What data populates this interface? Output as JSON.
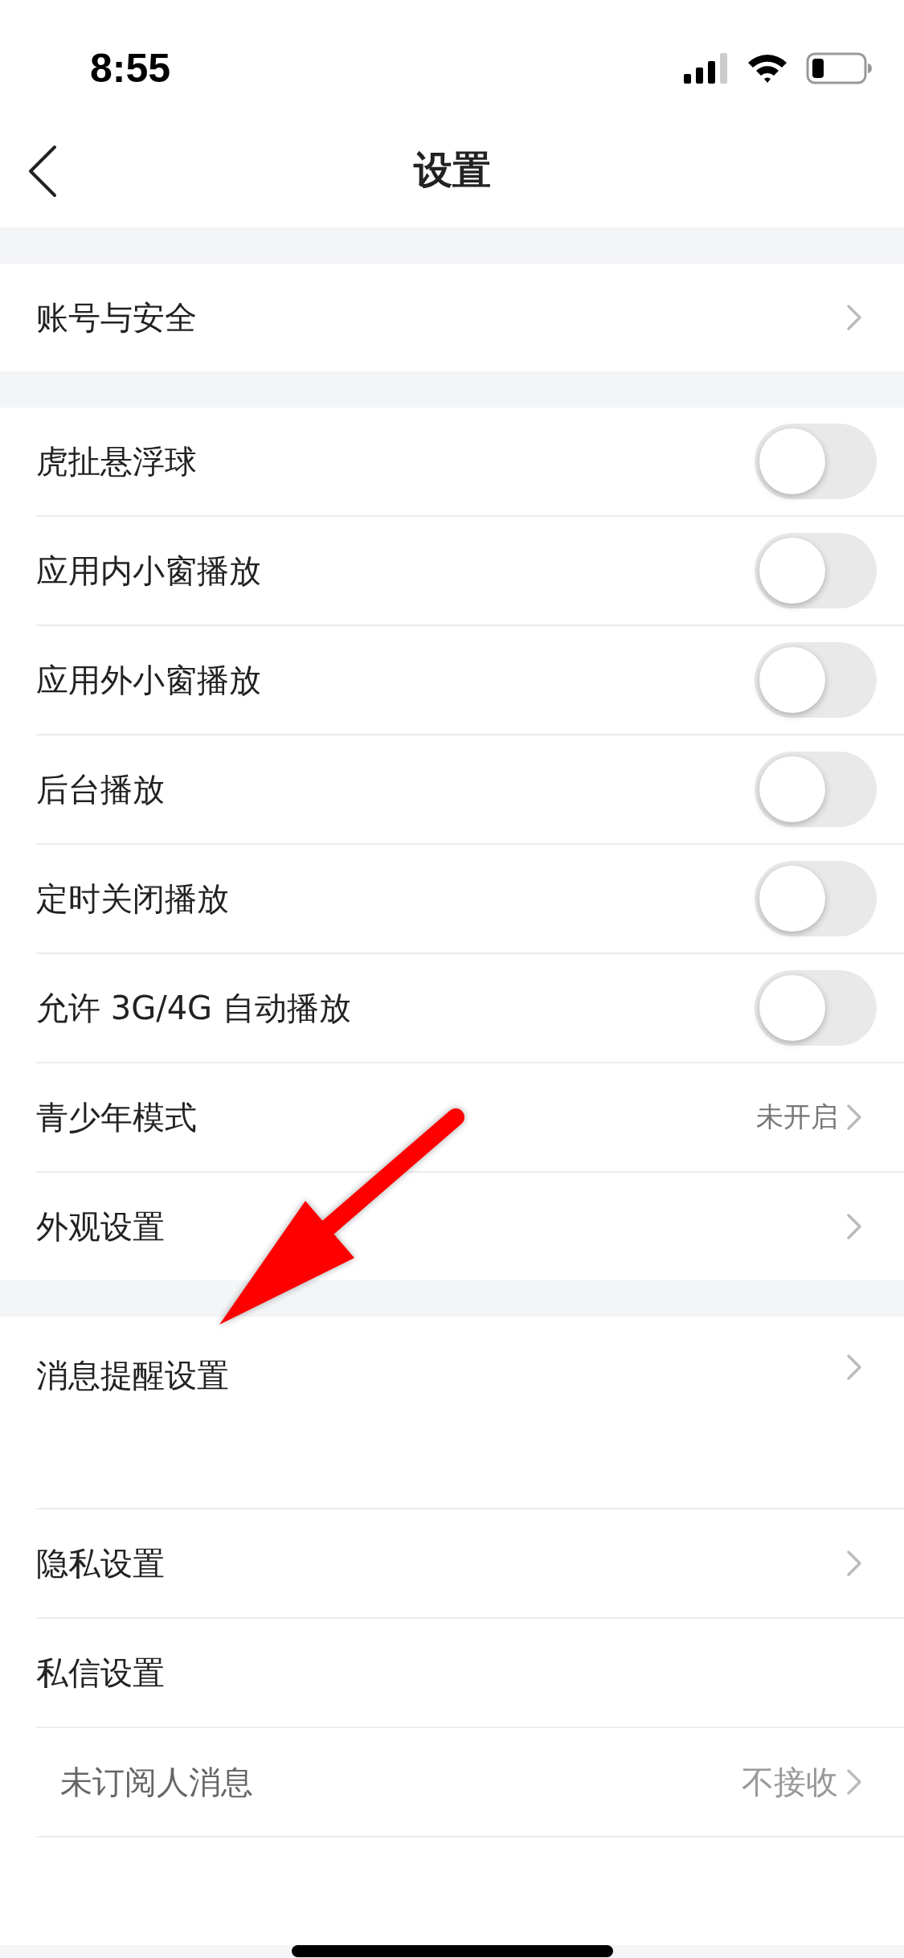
{
  "status_bar": {
    "time": "8:55"
  },
  "nav": {
    "title": "设置"
  },
  "sections": [
    {
      "rows": [
        {
          "kind": "link",
          "label": "账号与安全"
        }
      ]
    },
    {
      "rows": [
        {
          "kind": "toggle",
          "label": "虎扯悬浮球",
          "on": false
        },
        {
          "kind": "toggle",
          "label": "应用内小窗播放",
          "on": false
        },
        {
          "kind": "toggle",
          "label": "应用外小窗播放",
          "on": false
        },
        {
          "kind": "toggle",
          "label": "后台播放",
          "on": false
        },
        {
          "kind": "toggle",
          "label": "定时关闭播放",
          "on": false
        },
        {
          "kind": "toggle",
          "label": "允许 3G/4G 自动播放",
          "on": false
        },
        {
          "kind": "value",
          "label": "青少年模式",
          "value": "未开启"
        },
        {
          "kind": "link",
          "label": "外观设置"
        }
      ]
    },
    {
      "rows": [
        {
          "kind": "tall",
          "label": "消息提醒设置"
        },
        {
          "kind": "link",
          "label": "隐私设置"
        },
        {
          "kind": "plain",
          "label": "私信设置"
        },
        {
          "kind": "subvalue",
          "label": "未订阅人消息",
          "value": "不接收"
        },
        {
          "kind": "cut"
        }
      ]
    }
  ]
}
